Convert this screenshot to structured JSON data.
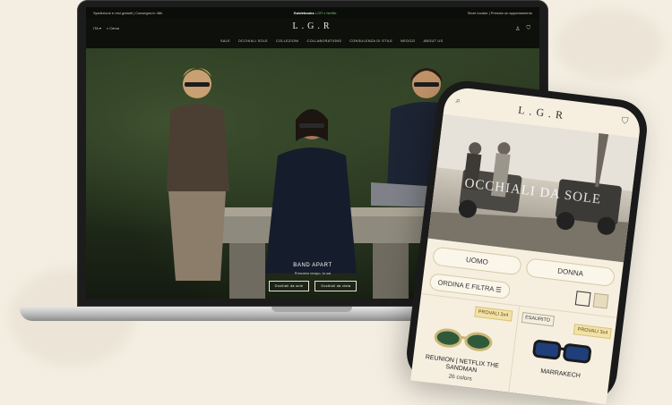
{
  "laptop": {
    "topbar": {
      "left": "Spedizione e resi gratuiti | Consegna in 48h",
      "center_brand": "Guidebooks",
      "center_rest": "LGR x Netflix",
      "right": "Store locator | Prenota un appuntamento"
    },
    "nav_left": [
      "ITA ▾",
      "Cerca"
    ],
    "logo": "L.G.R",
    "menu": [
      "Sale",
      "Occhiali sole",
      "Collezioni",
      "Collaborations",
      "Consulenza di stile",
      "Negozi",
      "About us"
    ],
    "hero": {
      "title": "BAND APART",
      "subtitle": "Prendere tempo, tu sai",
      "buttons": [
        "Occhiali da sole",
        "Occhiali da vista"
      ]
    }
  },
  "phone": {
    "logo": "L.G.R",
    "hero_title": "OCCHIALI DA SOLE",
    "tabs": [
      "UOMO",
      "DONNA"
    ],
    "filter_label": "ORDINA E FILTRA ☰",
    "products": [
      {
        "badges": [
          "PROVALI 3x4"
        ],
        "name": "REUNION | NETFLIX THE SANDMAN",
        "colors": "26 colors",
        "lens_color": "#2f5a3a",
        "frame_color": "#c9b777"
      },
      {
        "badges": [
          "ESAURITO",
          "PROVALI 3x4"
        ],
        "name": "MARRAKECH",
        "colors": "",
        "lens_color": "#1f3f7a",
        "frame_color": "#1a1a1a"
      }
    ]
  }
}
